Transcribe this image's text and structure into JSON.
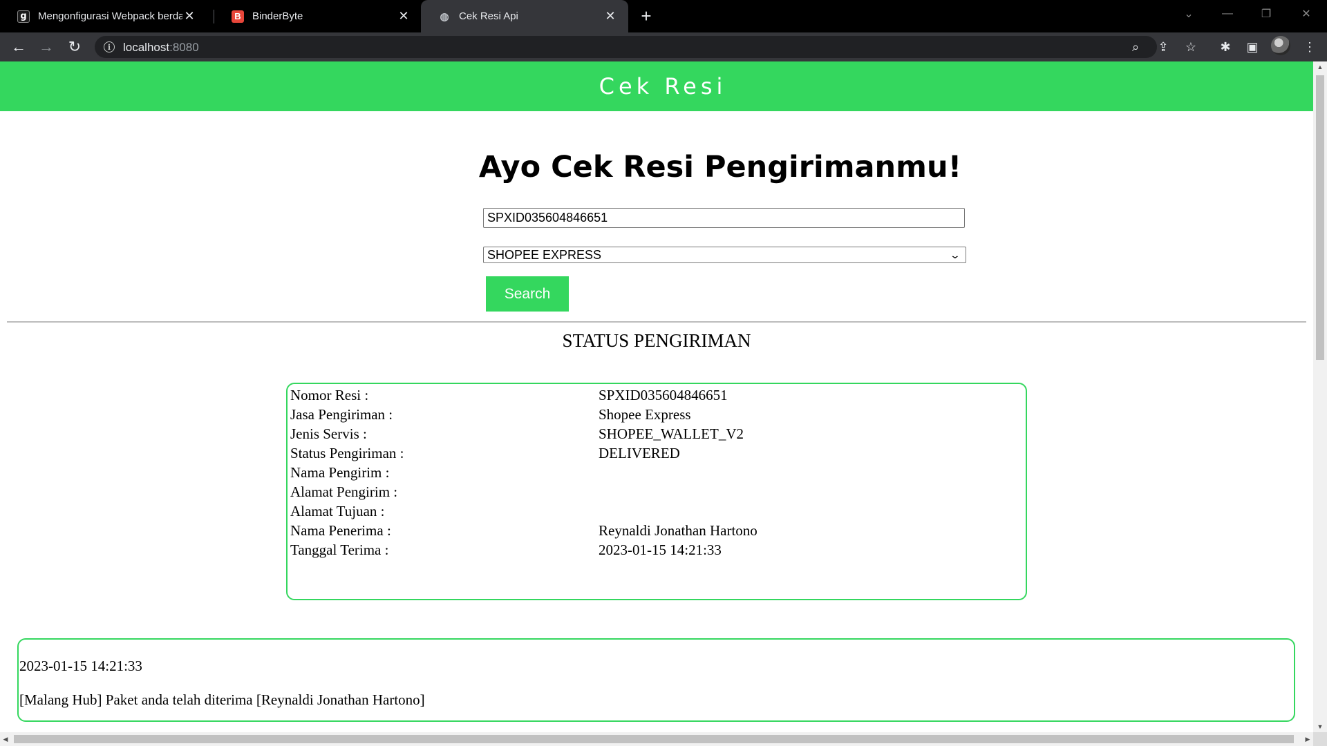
{
  "browser": {
    "tabs": [
      {
        "title": "Mengonfigurasi Webpack berdas",
        "favicon": "g",
        "favicon_color": "#ffffff",
        "favicon_bg": "#1a1a1a",
        "active": false
      },
      {
        "title": "BinderByte",
        "favicon": "B",
        "favicon_color": "#ffffff",
        "favicon_bg": "#e8463a",
        "active": false
      },
      {
        "title": "Cek Resi Api",
        "favicon": "🌐",
        "favicon_color": "#bdc1c6",
        "favicon_bg": "transparent",
        "active": true
      }
    ],
    "address_host": "localhost",
    "address_port": ":8080"
  },
  "header": {
    "brand": "Cek Resi"
  },
  "hero": {
    "title": "Ayo Cek Resi Pengirimanmu!"
  },
  "form": {
    "resi_value": "SPXID035604846651",
    "courier_selected": "SHOPEE EXPRESS",
    "search_label": "Search"
  },
  "status": {
    "title": "STATUS PENGIRIMAN",
    "rows": [
      {
        "label": "Nomor Resi :",
        "value": "SPXID035604846651"
      },
      {
        "label": "Jasa Pengiriman :",
        "value": "Shopee Express"
      },
      {
        "label": "Jenis Servis :",
        "value": "SHOPEE_WALLET_V2"
      },
      {
        "label": "Status Pengiriman :",
        "value": "DELIVERED"
      },
      {
        "label": "Nama Pengirim :",
        "value": ""
      },
      {
        "label": "Alamat Pengirim :",
        "value": ""
      },
      {
        "label": "Alamat Tujuan :",
        "value": ""
      },
      {
        "label": "Nama Penerima :",
        "value": "Reynaldi Jonathan Hartono"
      },
      {
        "label": "Tanggal Terima :",
        "value": "2023-01-15 14:21:33"
      }
    ]
  },
  "history": [
    {
      "date": "2023-01-15 14:21:33",
      "desc": "[Malang Hub] Paket anda telah diterima [Reynaldi Jonathan Hartono]"
    }
  ],
  "colors": {
    "accent": "#34d75e",
    "chrome_dark": "#000000",
    "chrome_toolbar": "#35363a"
  }
}
